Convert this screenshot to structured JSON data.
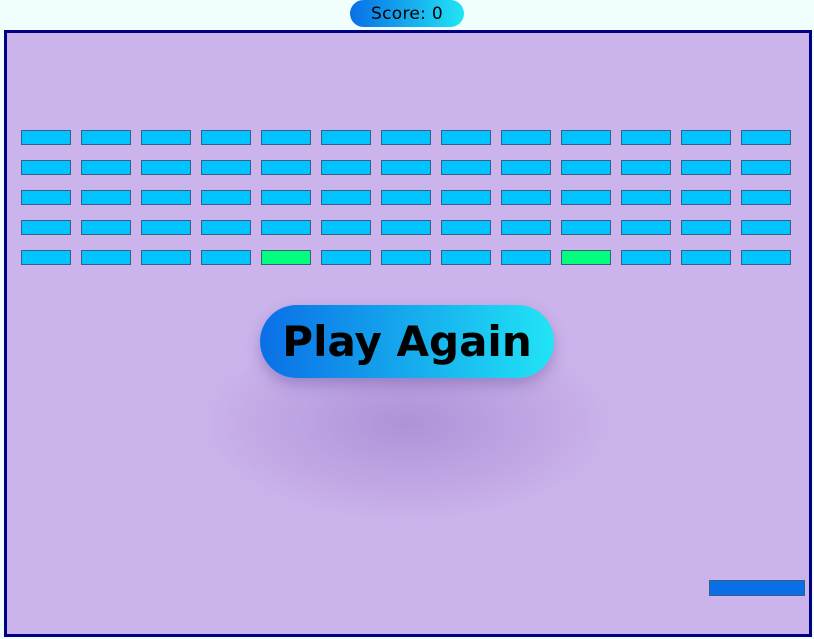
{
  "score": {
    "label": "Score:",
    "value": "0"
  },
  "play_again": {
    "label": "Play Again"
  },
  "colors": {
    "board_background": "#cbb3eb",
    "board_border": "#000080",
    "brick_default": "#00c3ff",
    "brick_special": "#00ff7f",
    "paddle": "#0a6fe6",
    "button_gradient_start": "#0a6fe6",
    "button_gradient_end": "#21e4f5"
  },
  "bricks": {
    "rows": [
      [
        "default",
        "default",
        "default",
        "default",
        "default",
        "default",
        "default",
        "default",
        "default",
        "default",
        "default",
        "default",
        "default"
      ],
      [
        "default",
        "default",
        "default",
        "default",
        "default",
        "default",
        "default",
        "default",
        "default",
        "default",
        "default",
        "default",
        "default"
      ],
      [
        "default",
        "default",
        "default",
        "default",
        "default",
        "default",
        "default",
        "default",
        "default",
        "default",
        "default",
        "default",
        "default"
      ],
      [
        "default",
        "default",
        "default",
        "default",
        "default",
        "default",
        "default",
        "default",
        "default",
        "default",
        "default",
        "default",
        "default"
      ],
      [
        "default",
        "default",
        "default",
        "default",
        "special",
        "default",
        "default",
        "default",
        "default",
        "special",
        "default",
        "default",
        "default"
      ]
    ]
  }
}
